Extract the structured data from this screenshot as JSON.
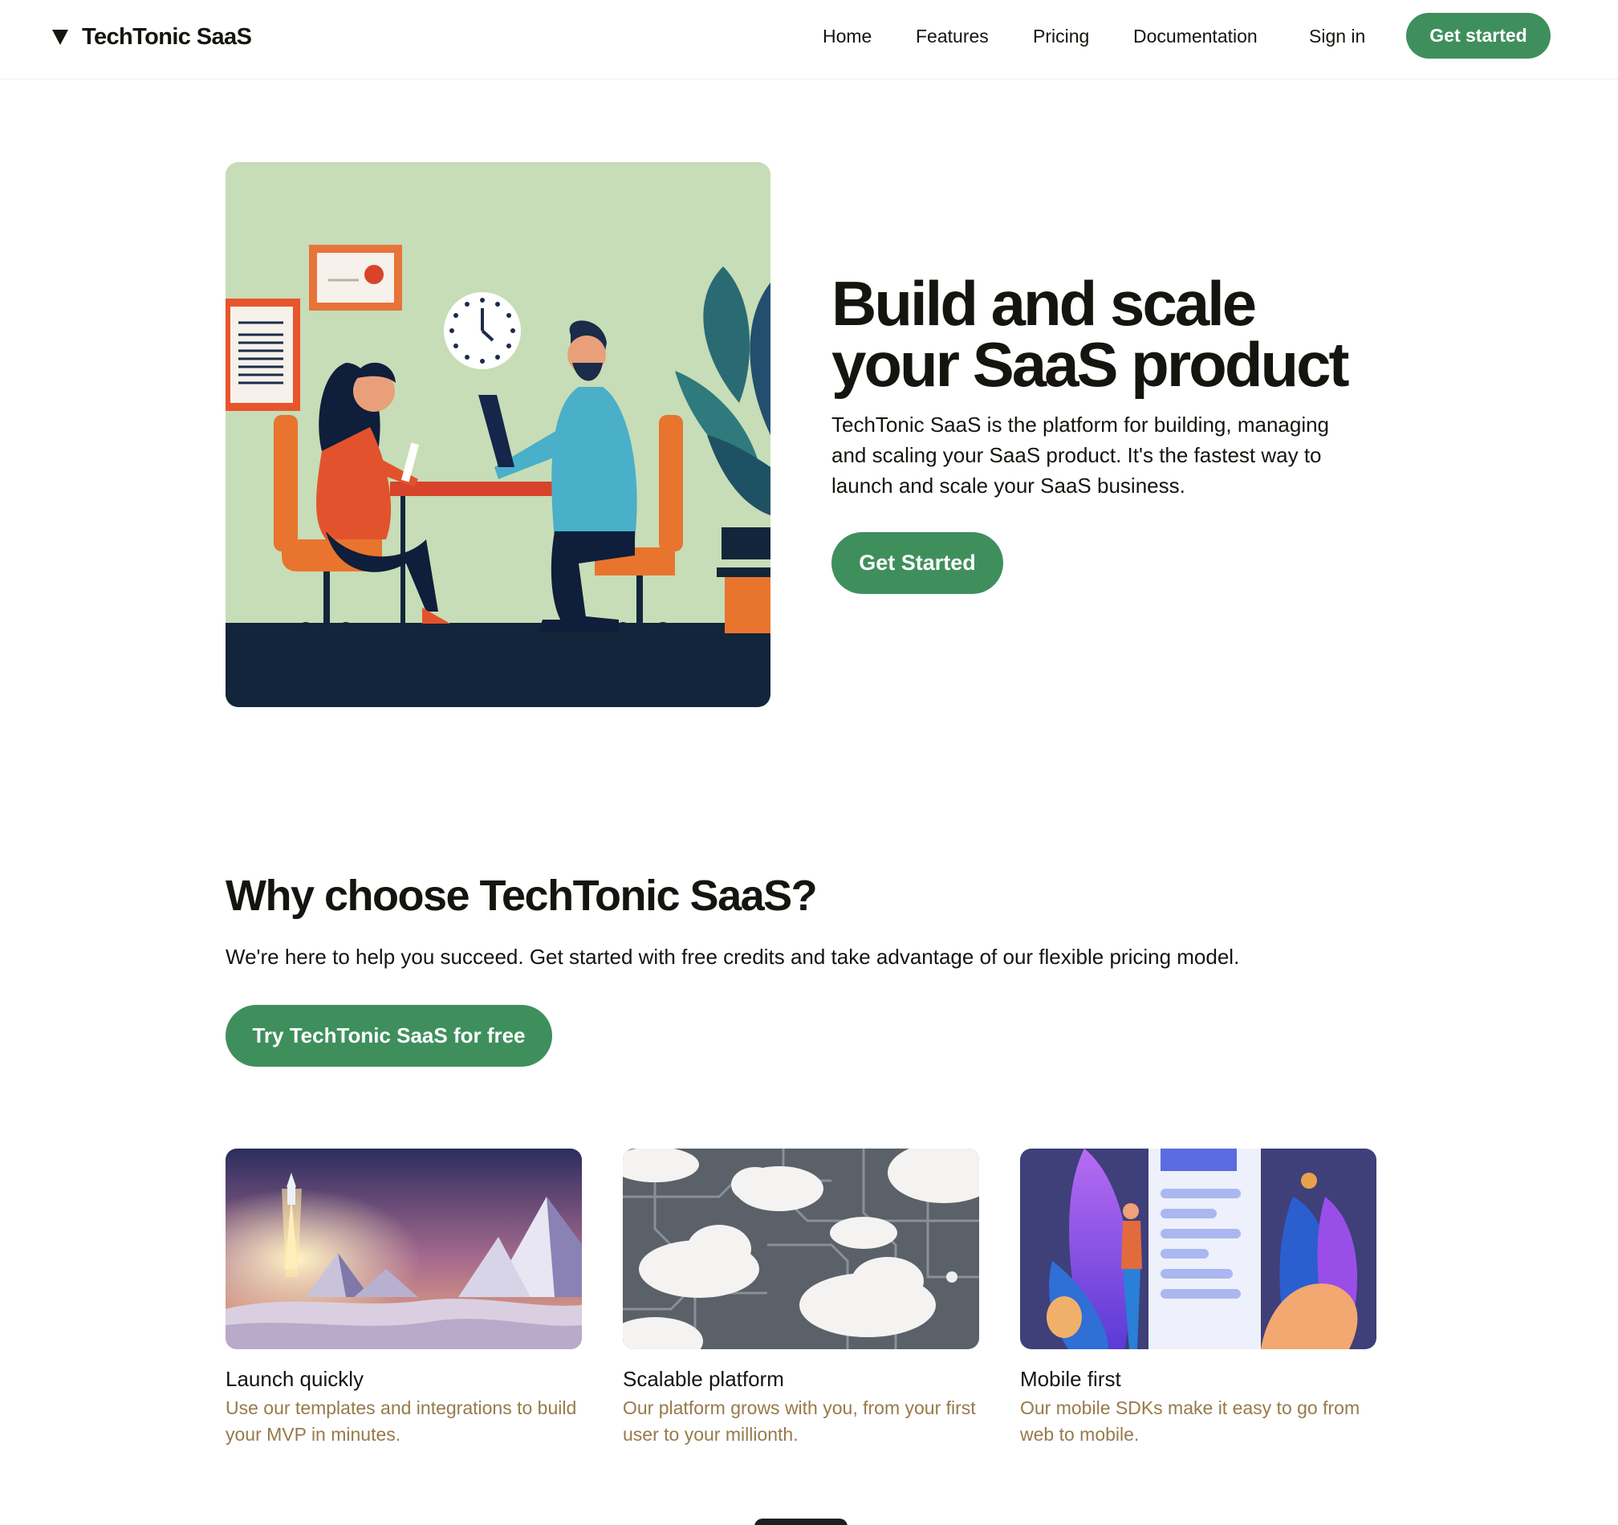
{
  "header": {
    "brand": "TechTonic SaaS",
    "nav": [
      {
        "label": "Home"
      },
      {
        "label": "Features"
      },
      {
        "label": "Pricing"
      },
      {
        "label": "Documentation"
      },
      {
        "label": "Sign in"
      }
    ],
    "cta_label": "Get started"
  },
  "hero": {
    "title_line1": "Build and scale",
    "title_line2": "your SaaS product",
    "description": "TechTonic SaaS is the platform for building, managing and scaling your SaaS product. It's the fastest way to launch and scale your SaaS business.",
    "cta_label": "Get Started"
  },
  "why": {
    "title": "Why choose TechTonic SaaS?",
    "description": "We're here to help you succeed. Get started with free credits and take advantage of our flexible pricing model.",
    "cta_label": "Try TechTonic SaaS for free"
  },
  "features": [
    {
      "title": "Launch quickly",
      "description": "Use our templates and integrations to build your MVP in minutes."
    },
    {
      "title": "Scalable platform",
      "description": "Our platform grows with you, from your first user to your millionth."
    },
    {
      "title": "Mobile first",
      "description": "Our mobile SDKs make it easy to go from web to mobile."
    }
  ],
  "colors": {
    "accent": "#3f8f5d",
    "text": "#16140f",
    "muted": "#977a4b",
    "hero_bg": "#c6ddb7"
  }
}
